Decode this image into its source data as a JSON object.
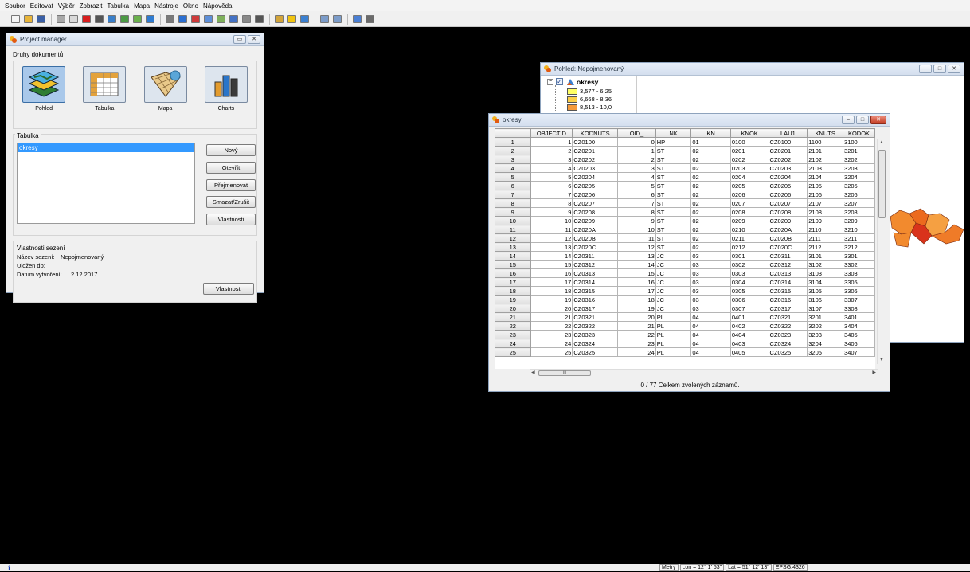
{
  "menu": [
    "Soubor",
    "Editovat",
    "Výběr",
    "Zobrazit",
    "Tabulka",
    "Mapa",
    "Nástroje",
    "Okno",
    "Nápověda"
  ],
  "toolbar_icons": [
    {
      "name": "new-icon",
      "color": "#f5f5f5"
    },
    {
      "name": "open-icon",
      "color": "#e8b53a"
    },
    {
      "name": "save-icon",
      "color": "#3a5fa5"
    },
    {
      "sep": true
    },
    {
      "name": "back-icon",
      "color": "#a8a8a8"
    },
    {
      "name": "pointer-icon",
      "color": "#d9d9d9"
    },
    {
      "name": "stop-icon",
      "color": "#d81e1e"
    },
    {
      "name": "tools-icon",
      "color": "#555555"
    },
    {
      "name": "layers-icon",
      "color": "#3a7fc9"
    },
    {
      "name": "grid-icon",
      "color": "#4c9a45"
    },
    {
      "name": "add-layer-icon",
      "color": "#6ab04c"
    },
    {
      "name": "table-icon",
      "color": "#2f7bd0"
    },
    {
      "sep": true
    },
    {
      "name": "print-icon",
      "color": "#7a7a7a"
    },
    {
      "name": "filter-icon",
      "color": "#2c6fd1"
    },
    {
      "name": "clear-icon",
      "color": "#cf3b3b"
    },
    {
      "name": "select-icon",
      "color": "#5e8fd8"
    },
    {
      "name": "query-icon",
      "color": "#7fb05b"
    },
    {
      "name": "sort-icon",
      "color": "#4472c4"
    },
    {
      "name": "stats-icon",
      "color": "#888888"
    },
    {
      "name": "sum-icon",
      "color": "#555555"
    },
    {
      "sep": true
    },
    {
      "name": "graph-icon",
      "color": "#d2a43a"
    },
    {
      "name": "star-icon",
      "color": "#f1c40f"
    },
    {
      "name": "order-icon",
      "color": "#3b80d0"
    },
    {
      "sep": true
    },
    {
      "name": "prev-icon",
      "color": "#7c9cc9"
    },
    {
      "name": "next-icon",
      "color": "#7c9cc9"
    },
    {
      "sep": true
    },
    {
      "name": "image-icon",
      "color": "#4a7fd4"
    },
    {
      "name": "print-layout-icon",
      "color": "#6a6a6a"
    }
  ],
  "project_manager": {
    "title": "Project manager",
    "doc_types_label": "Druhy dokumentů",
    "doc_types": [
      {
        "label": "Pohled",
        "icon": "view-icon"
      },
      {
        "label": "Tabulka",
        "icon": "table-doc-icon"
      },
      {
        "label": "Mapa",
        "icon": "map-doc-icon"
      },
      {
        "label": "Charts",
        "icon": "charts-icon"
      }
    ],
    "table_section_label": "Tabulka",
    "tables": [
      "okresy"
    ],
    "buttons": {
      "new": "Nový",
      "open": "Otevřít",
      "rename": "Přejmenovat",
      "delete": "Smazat/Zrušit",
      "properties": "Vlastnosti"
    },
    "session_label": "Vlastnosti sezení",
    "session": {
      "name_label": "Název sezení:",
      "name_value": "Nepojmenovaný",
      "saved_label": "Uložen do:",
      "saved_value": "",
      "created_label": "Datum vytvoření:",
      "created_value": "2.12.2017"
    },
    "session_button": "Vlastnosti"
  },
  "pohled": {
    "title": "Pohled: Nepojmenovaný",
    "layer_name": "okresy",
    "legend": [
      {
        "label": "3,577 - 6,25",
        "color": "#ffff66"
      },
      {
        "label": "6,668 - 8,36",
        "color": "#fcd04a"
      },
      {
        "label": "8,513 - 10,0",
        "color": "#f59a3b"
      }
    ],
    "map_colors": [
      "#f28a2e",
      "#ec6a1e",
      "#d9331b",
      "#f5a042",
      "#ef7b28"
    ]
  },
  "okresy": {
    "title": "okresy",
    "columns": [
      "OBJECTID",
      "KODNUTS",
      "OID_",
      "NK",
      "KN",
      "KNOK",
      "LAU1",
      "KNUTS",
      "KODOK"
    ],
    "rows": [
      [
        "1",
        "CZ0100",
        "0",
        "HP",
        "01",
        "0100",
        "CZ0100",
        "1100",
        "3100"
      ],
      [
        "2",
        "CZ0201",
        "1",
        "ST",
        "02",
        "0201",
        "CZ0201",
        "2101",
        "3201"
      ],
      [
        "3",
        "CZ0202",
        "2",
        "ST",
        "02",
        "0202",
        "CZ0202",
        "2102",
        "3202"
      ],
      [
        "4",
        "CZ0203",
        "3",
        "ST",
        "02",
        "0203",
        "CZ0203",
        "2103",
        "3203"
      ],
      [
        "5",
        "CZ0204",
        "4",
        "ST",
        "02",
        "0204",
        "CZ0204",
        "2104",
        "3204"
      ],
      [
        "6",
        "CZ0205",
        "5",
        "ST",
        "02",
        "0205",
        "CZ0205",
        "2105",
        "3205"
      ],
      [
        "7",
        "CZ0206",
        "6",
        "ST",
        "02",
        "0206",
        "CZ0206",
        "2106",
        "3206"
      ],
      [
        "8",
        "CZ0207",
        "7",
        "ST",
        "02",
        "0207",
        "CZ0207",
        "2107",
        "3207"
      ],
      [
        "9",
        "CZ0208",
        "8",
        "ST",
        "02",
        "0208",
        "CZ0208",
        "2108",
        "3208"
      ],
      [
        "10",
        "CZ0209",
        "9",
        "ST",
        "02",
        "0209",
        "CZ0209",
        "2109",
        "3209"
      ],
      [
        "11",
        "CZ020A",
        "10",
        "ST",
        "02",
        "0210",
        "CZ020A",
        "2110",
        "3210"
      ],
      [
        "12",
        "CZ020B",
        "11",
        "ST",
        "02",
        "0211",
        "CZ020B",
        "2111",
        "3211"
      ],
      [
        "13",
        "CZ020C",
        "12",
        "ST",
        "02",
        "0212",
        "CZ020C",
        "2112",
        "3212"
      ],
      [
        "14",
        "CZ0311",
        "13",
        "JC",
        "03",
        "0301",
        "CZ0311",
        "3101",
        "3301"
      ],
      [
        "15",
        "CZ0312",
        "14",
        "JC",
        "03",
        "0302",
        "CZ0312",
        "3102",
        "3302"
      ],
      [
        "16",
        "CZ0313",
        "15",
        "JC",
        "03",
        "0303",
        "CZ0313",
        "3103",
        "3303"
      ],
      [
        "17",
        "CZ0314",
        "16",
        "JC",
        "03",
        "0304",
        "CZ0314",
        "3104",
        "3305"
      ],
      [
        "18",
        "CZ0315",
        "17",
        "JC",
        "03",
        "0305",
        "CZ0315",
        "3105",
        "3306"
      ],
      [
        "19",
        "CZ0316",
        "18",
        "JC",
        "03",
        "0306",
        "CZ0316",
        "3106",
        "3307"
      ],
      [
        "20",
        "CZ0317",
        "19",
        "JC",
        "03",
        "0307",
        "CZ0317",
        "3107",
        "3308"
      ],
      [
        "21",
        "CZ0321",
        "20",
        "PL",
        "04",
        "0401",
        "CZ0321",
        "3201",
        "3401"
      ],
      [
        "22",
        "CZ0322",
        "21",
        "PL",
        "04",
        "0402",
        "CZ0322",
        "3202",
        "3404"
      ],
      [
        "23",
        "CZ0323",
        "22",
        "PL",
        "04",
        "0404",
        "CZ0323",
        "3203",
        "3405"
      ],
      [
        "24",
        "CZ0324",
        "23",
        "PL",
        "04",
        "0403",
        "CZ0324",
        "3204",
        "3406"
      ],
      [
        "25",
        "CZ0325",
        "24",
        "PL",
        "04",
        "0405",
        "CZ0325",
        "3205",
        "3407"
      ]
    ],
    "footer": "0 / 77 Celkem zvolených záznamů.",
    "hscroll_glyph": "III"
  },
  "status": {
    "info": "i",
    "units": "Metry",
    "lon": "Lon = 12° 1' 53\"",
    "lat": "Lat = 51° 12' 13\"",
    "epsg": "EPSG:4326"
  }
}
